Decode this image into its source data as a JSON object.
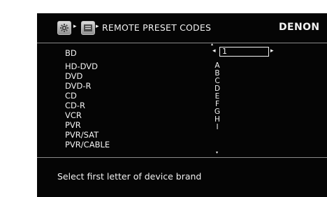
{
  "header": {
    "breadcrumb_arrow_1": "▸",
    "breadcrumb_arrow_2": "▸",
    "title": "REMOTE PRESET CODES",
    "brand": "DENON"
  },
  "devices": [
    "BD",
    "HD-DVD",
    "DVD",
    "DVD-R",
    "CD",
    "CD-R",
    "VCR",
    "PVR",
    "PVR/SAT",
    "PVR/CABLE"
  ],
  "selector": {
    "value": "1",
    "left_arrow": "◂",
    "right_arrow": "▸",
    "up_arrow": "▴",
    "down_arrow": "▾"
  },
  "letters": [
    "A",
    "B",
    "C",
    "D",
    "E",
    "F",
    "G",
    "H",
    "I"
  ],
  "footer": {
    "hint": "Select first letter of device brand"
  },
  "icons": {
    "setup": "gear-icon",
    "menu": "remote-icon"
  }
}
